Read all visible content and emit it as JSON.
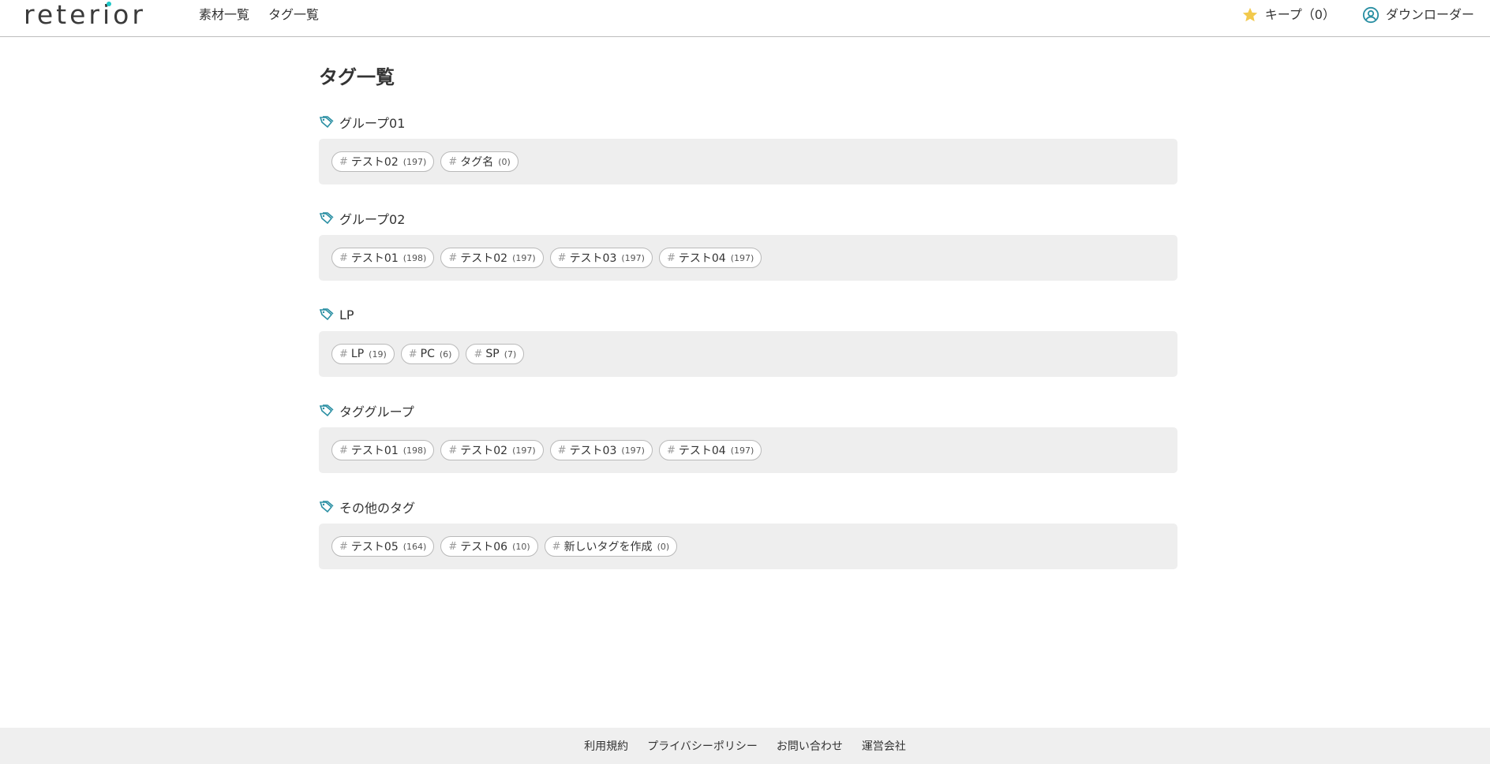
{
  "header": {
    "logo_text": "reterior",
    "nav": [
      {
        "label": "素材一覧"
      },
      {
        "label": "タグ一覧"
      }
    ],
    "keep_label": "キープ（0）",
    "downloader_label": "ダウンローダー"
  },
  "main": {
    "title": "タグ一覧",
    "groups": [
      {
        "name": "グループ01",
        "tags": [
          {
            "name": "テスト02",
            "count": "(197)"
          },
          {
            "name": "タグ名",
            "count": "(0)"
          }
        ]
      },
      {
        "name": "グループ02",
        "tags": [
          {
            "name": "テスト01",
            "count": "(198)"
          },
          {
            "name": "テスト02",
            "count": "(197)"
          },
          {
            "name": "テスト03",
            "count": "(197)"
          },
          {
            "name": "テスト04",
            "count": "(197)"
          }
        ]
      },
      {
        "name": "LP",
        "tags": [
          {
            "name": "LP",
            "count": "(19)"
          },
          {
            "name": "PC",
            "count": "(6)"
          },
          {
            "name": "SP",
            "count": "(7)"
          }
        ]
      },
      {
        "name": "タググループ",
        "tags": [
          {
            "name": "テスト01",
            "count": "(198)"
          },
          {
            "name": "テスト02",
            "count": "(197)"
          },
          {
            "name": "テスト03",
            "count": "(197)"
          },
          {
            "name": "テスト04",
            "count": "(197)"
          }
        ]
      },
      {
        "name": "その他のタグ",
        "tags": [
          {
            "name": "テスト05",
            "count": "(164)"
          },
          {
            "name": "テスト06",
            "count": "(10)"
          },
          {
            "name": "新しいタグを作成",
            "count": "(0)"
          }
        ]
      }
    ]
  },
  "footer": {
    "links": [
      {
        "label": "利用規約"
      },
      {
        "label": "プライバシーポリシー"
      },
      {
        "label": "お問い合わせ"
      },
      {
        "label": "運営会社"
      }
    ]
  },
  "colors": {
    "accent": "#1ec8c8",
    "tag_icon": "#2a8fa3",
    "star": "#f2c94c",
    "group_bg": "#eeeeee",
    "footer_bg": "#efefef"
  },
  "icons": {
    "star": "star-icon",
    "user": "user-circle-icon",
    "tag": "tag-icon",
    "hash": "#"
  }
}
